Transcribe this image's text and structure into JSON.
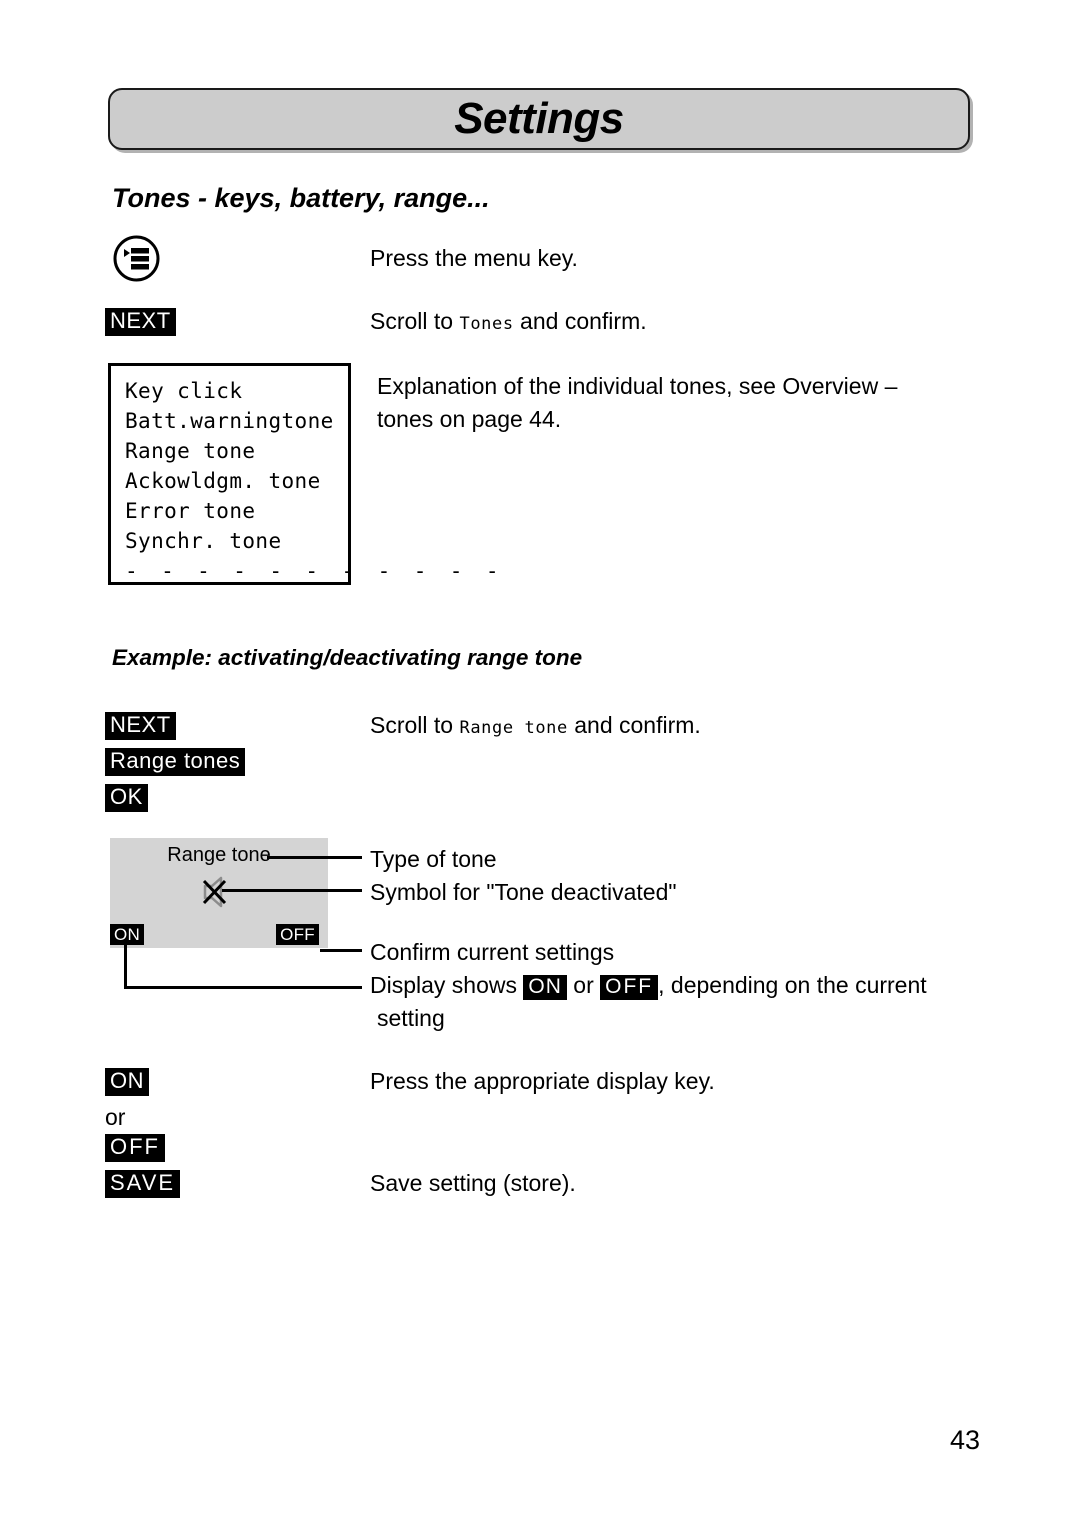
{
  "page": {
    "banner_title": "Settings",
    "number": "43"
  },
  "section_tones": {
    "heading": "Tones - keys, battery, range...",
    "steps": [
      {
        "key_icon": "menu-key-icon",
        "text": "Press the menu key."
      },
      {
        "badge": "NEXT",
        "text_before": "Scroll to ",
        "lcd_term": "Tones",
        "text_after": " and confirm."
      }
    ],
    "explanation_line1": "Explanation of the individual tones, see Overview –",
    "explanation_line2": "tones on page 44.",
    "lcd_list": [
      "Key click",
      "Batt.warningtone",
      "Range tone",
      "Ackowldgm. tone",
      "Error tone",
      "Synchr. tone"
    ],
    "lcd_list_separator": "- - - - - - - - - - -"
  },
  "section_example": {
    "heading": "Example: activating/deactivating range tone",
    "scroll_text_before": "Scroll to ",
    "scroll_lcd_term": "Range  tone",
    "scroll_text_after": " and confirm.",
    "keys": [
      {
        "label": "NEXT"
      },
      {
        "label": "Range tones"
      },
      {
        "label": "OK"
      }
    ],
    "display": {
      "title": "Range tone",
      "symbol": "muted-speaker-icon",
      "softkey_left": "ON",
      "softkey_right": "OFF"
    },
    "callouts": [
      "Type of tone",
      "Symbol for \"Tone deactivated\"",
      "Confirm current settings"
    ],
    "callout_display_shows": {
      "prefix": "Display shows ",
      "badge_on": "ON",
      "middle": " or ",
      "badge_off": "OFF",
      "suffix": ", depending on the current",
      "second_line": "setting"
    },
    "final_steps": [
      {
        "badge": "ON",
        "text": "Press the appropriate display key."
      },
      {
        "plain": "or",
        "text": ""
      },
      {
        "badge": "OFF",
        "text": ""
      },
      {
        "badge": "SAVE",
        "text": "Save setting (store)."
      }
    ]
  }
}
